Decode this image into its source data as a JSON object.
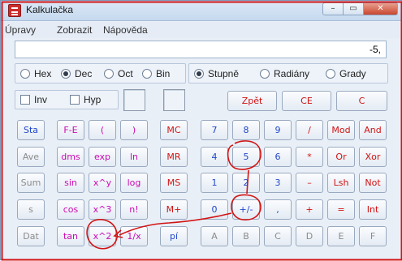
{
  "window": {
    "title": "Kalkulačka",
    "minimize": "–",
    "maximize": "▭",
    "close": "✕"
  },
  "menu": [
    "Úpravy",
    "Zobrazit",
    "Nápověda"
  ],
  "display": {
    "value": "-5,"
  },
  "number_system": {
    "hex": "Hex",
    "dec": "Dec",
    "oct": "Oct",
    "bin": "Bin",
    "selected": "Dec"
  },
  "angle_units": {
    "degrees": "Stupně",
    "radians": "Radiány",
    "grads": "Grady",
    "selected": "Stupně"
  },
  "options": {
    "inv": "Inv",
    "hyp": "Hyp"
  },
  "edit_keys": {
    "backspace": "Zpět",
    "ce": "CE",
    "c": "C"
  },
  "stat_keys": {
    "sta": "Sta",
    "ave": "Ave",
    "sum": "Sum",
    "s": "s",
    "dat": "Dat"
  },
  "sci_keys": {
    "fe": "F-E",
    "lparen": "(",
    "rparen": ")",
    "dms": "dms",
    "exp": "exp",
    "ln": "ln",
    "sin": "sin",
    "xy": "x^y",
    "log": "log",
    "cos": "cos",
    "x3": "x^3",
    "nfact": "n!",
    "tan": "tan",
    "x2": "x^2",
    "inv_x": "1/x",
    "pi": "pí"
  },
  "mem_keys": {
    "mc": "MC",
    "mr": "MR",
    "ms": "MS",
    "mplus": "M+"
  },
  "digit_keys": {
    "d7": "7",
    "d8": "8",
    "d9": "9",
    "d4": "4",
    "d5": "5",
    "d6": "6",
    "d1": "1",
    "d2": "2",
    "d3": "3",
    "d0": "0",
    "sign": "+/-",
    "dot": ","
  },
  "hex_keys": {
    "a": "A",
    "b": "B",
    "c": "C",
    "d": "D",
    "e": "E",
    "f": "F"
  },
  "op_keys": {
    "div": "/",
    "mul": "*",
    "minus": "–",
    "plus": "+",
    "eq": "=",
    "mod": "Mod",
    "and": "And",
    "or": "Or",
    "xor": "Xor",
    "lsh": "Lsh",
    "not": "Not",
    "int": "Int"
  },
  "colors": {
    "blue": "#2246c9",
    "magenta": "#cc0bb4",
    "red": "#d11313",
    "annotation": "#d11313"
  }
}
